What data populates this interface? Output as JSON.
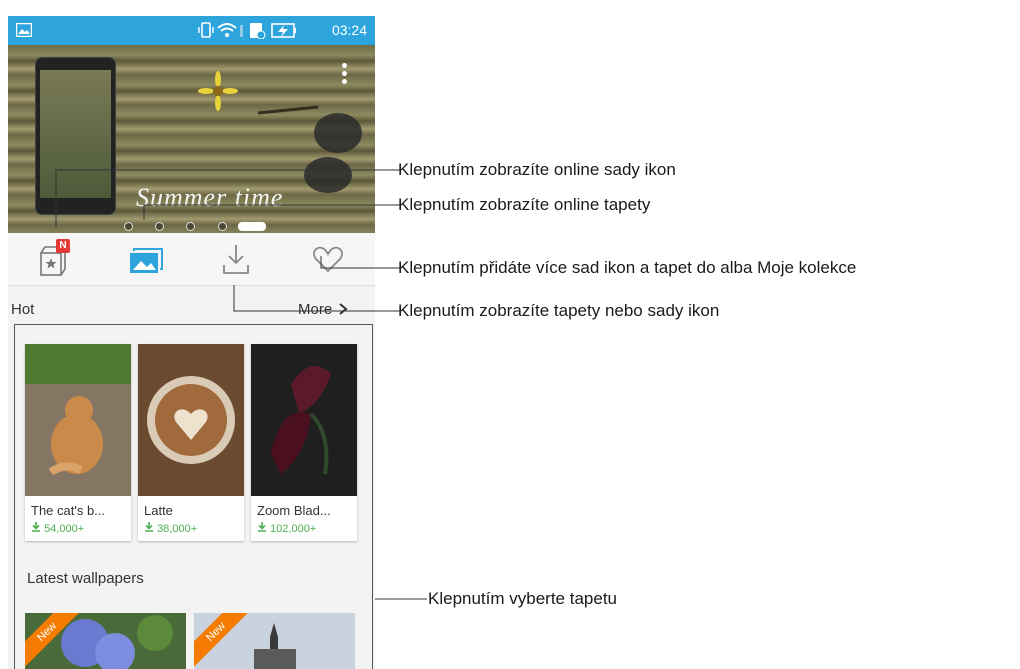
{
  "status_bar": {
    "time": "03:24"
  },
  "banner": {
    "text": "Summer time"
  },
  "tabs": {
    "badge": "N"
  },
  "hot": {
    "title": "Hot",
    "more_label": "More",
    "cards": [
      {
        "title": "The cat's b...",
        "downloads": "54,000+"
      },
      {
        "title": "Latte",
        "downloads": "38,000+"
      },
      {
        "title": "Zoom Blad...",
        "downloads": "102,000+"
      }
    ]
  },
  "latest": {
    "title": "Latest wallpapers",
    "ribbons": [
      "New",
      "New"
    ]
  },
  "callouts": {
    "icon_sets": "Klepnutím zobrazíte online sady ikon",
    "wallpapers": "Klepnutím zobrazíte online tapety",
    "collection": "Klepnutím přidáte více sad ikon a tapet do alba Moje kolekce",
    "downloads": "Klepnutím zobrazíte tapety nebo sady ikon",
    "select": "Klepnutím vyberte tapetu"
  },
  "colors": {
    "status_bar": "#2ea4dd",
    "accent": "#2ea4dd",
    "download_green": "#4caf50",
    "badge_red": "#e53935",
    "ribbon_orange": "#f57c00"
  }
}
